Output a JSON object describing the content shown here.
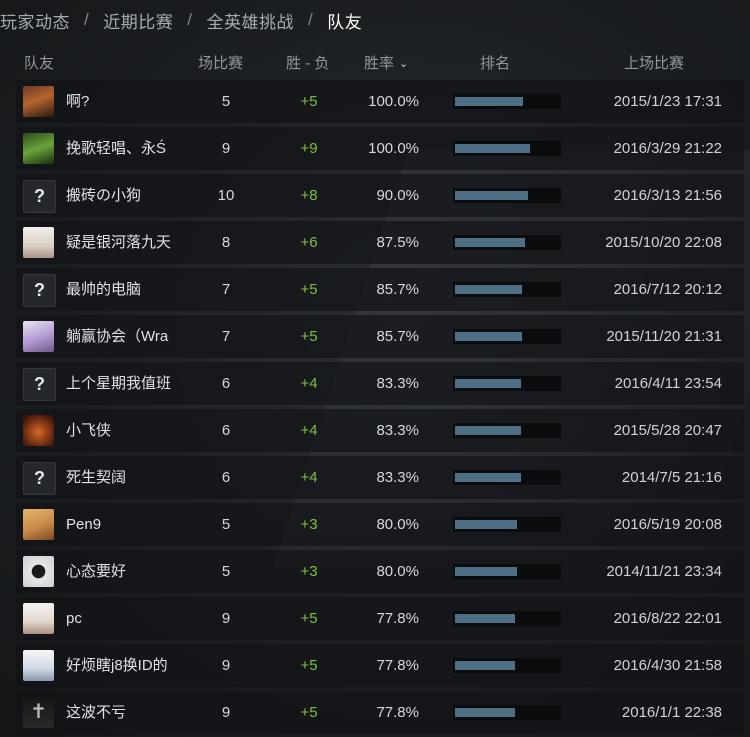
{
  "breadcrumb": [
    "玩家动态",
    "近期比赛",
    "全英雄挑战",
    "队友"
  ],
  "breadcrumb_sep": "/",
  "columns": {
    "teammate": "队友",
    "matches": "场比赛",
    "win_loss": "胜 - 负",
    "win_rate": "胜率",
    "rank": "排名",
    "last_match": "上场比赛"
  },
  "sort_icon": "chevron-down-icon",
  "rows": [
    {
      "name": "啊?",
      "avatar": "hero-portrait-cowboy",
      "matches": "5",
      "diff": "+5",
      "rate": "100.0%",
      "rank_fraction": 0.65,
      "last": "2015/1/23 17:31"
    },
    {
      "name": "挽歌轻唱、永Ś",
      "avatar": "hero-portrait-green",
      "matches": "9",
      "diff": "+9",
      "rate": "100.0%",
      "rank_fraction": 0.72,
      "last": "2016/3/29 21:22"
    },
    {
      "name": "搬砖の小狗",
      "avatar": "unknown",
      "matches": "10",
      "diff": "+8",
      "rate": "90.0%",
      "rank_fraction": 0.7,
      "last": "2016/3/13 21:56"
    },
    {
      "name": "疑是银河落九天",
      "avatar": "face-portrait",
      "matches": "8",
      "diff": "+6",
      "rate": "87.5%",
      "rank_fraction": 0.67,
      "last": "2015/10/20 22:08"
    },
    {
      "name": "最帅的电脑",
      "avatar": "unknown",
      "matches": "7",
      "diff": "+5",
      "rate": "85.7%",
      "rank_fraction": 0.64,
      "last": "2016/7/12 20:12"
    },
    {
      "name": "躺赢协会（Wra",
      "avatar": "anime-portrait",
      "matches": "7",
      "diff": "+5",
      "rate": "85.7%",
      "rank_fraction": 0.64,
      "last": "2015/11/20 21:31"
    },
    {
      "name": "上个星期我值班",
      "avatar": "unknown",
      "matches": "6",
      "diff": "+4",
      "rate": "83.3%",
      "rank_fraction": 0.63,
      "last": "2016/4/11 23:54"
    },
    {
      "name": "小飞侠",
      "avatar": "hero-portrait-fire",
      "matches": "6",
      "diff": "+4",
      "rate": "83.3%",
      "rank_fraction": 0.63,
      "last": "2015/5/28 20:47"
    },
    {
      "name": "死生契阔",
      "avatar": "unknown",
      "matches": "6",
      "diff": "+4",
      "rate": "83.3%",
      "rank_fraction": 0.63,
      "last": "2014/7/5 21:16"
    },
    {
      "name": "Pen9",
      "avatar": "face-portrait-2",
      "matches": "5",
      "diff": "+3",
      "rate": "80.0%",
      "rank_fraction": 0.6,
      "last": "2016/5/19 20:08"
    },
    {
      "name": "心态要好",
      "avatar": "spider-logo",
      "matches": "5",
      "diff": "+3",
      "rate": "80.0%",
      "rank_fraction": 0.6,
      "last": "2014/11/21 23:34"
    },
    {
      "name": "pc",
      "avatar": "face-portrait-3",
      "matches": "9",
      "diff": "+5",
      "rate": "77.8%",
      "rank_fraction": 0.58,
      "last": "2016/8/22 22:01"
    },
    {
      "name": "好烦瞎j8换ID的",
      "avatar": "cartoon-portrait",
      "matches": "9",
      "diff": "+5",
      "rate": "77.8%",
      "rank_fraction": 0.58,
      "last": "2016/4/30 21:58"
    },
    {
      "name": "这波不亏",
      "avatar": "cross-portrait",
      "matches": "9",
      "diff": "+5",
      "rate": "77.8%",
      "rank_fraction": 0.58,
      "last": "2016/1/1 22:38"
    }
  ],
  "unknown_avatar_glyph": "?",
  "colors": {
    "win": "#7fbf3f",
    "rank_fill": "#4f6f85",
    "active_crumb": "#ffffff"
  }
}
